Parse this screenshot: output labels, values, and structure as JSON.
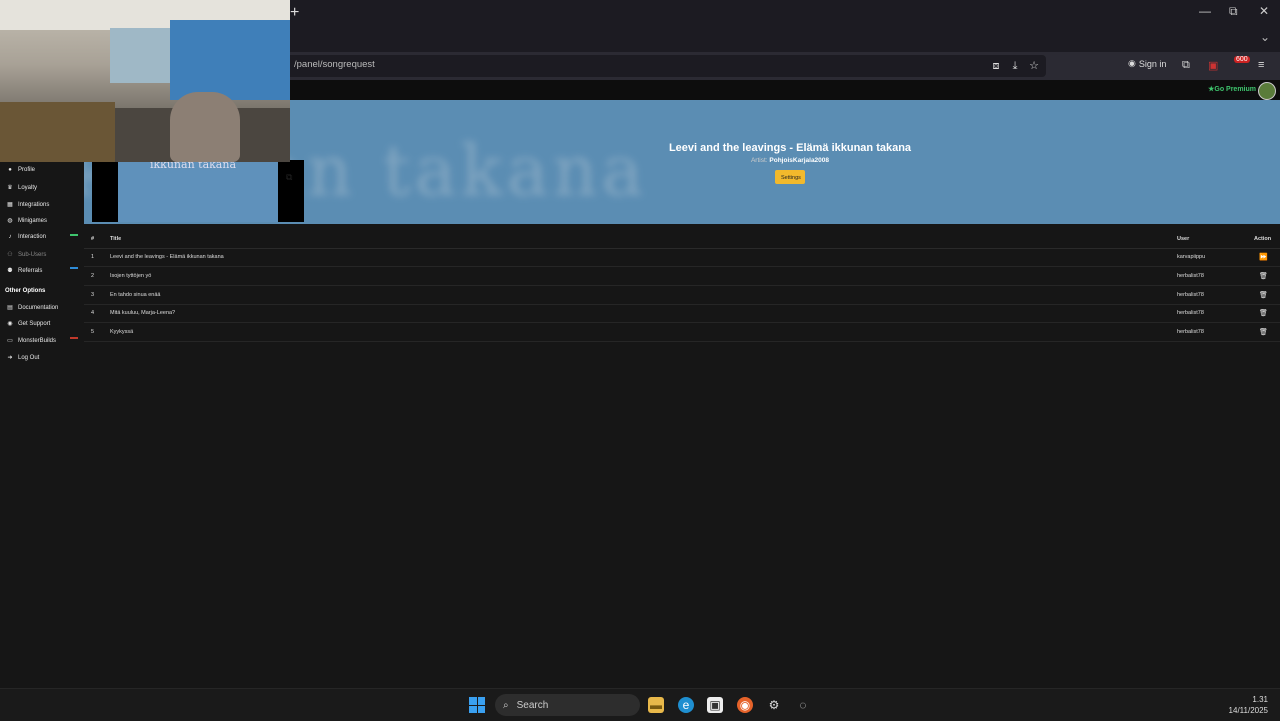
{
  "browser": {
    "new_tab": "+",
    "url": "/panel/songrequest",
    "sign_in": "Sign in",
    "extension_badge": "600",
    "window_controls": {
      "minimize": "—",
      "restore": "⧉",
      "close": "✕"
    }
  },
  "site_topbar": {
    "premium": "Go Premium"
  },
  "hero": {
    "background_text": "ikkunan takana",
    "thumbnail_caption": "ikkunan takana",
    "song_title": "Leevi and the leavings - Elämä ikkunan takana",
    "artist_label": "Artist:",
    "artist_name": "PohjoisKarjala2008",
    "settings_label": "Settings"
  },
  "sidebar": {
    "items": [
      {
        "label": "Profile",
        "icon": "person-icon"
      },
      {
        "label": "Loyalty",
        "icon": "trophy-icon"
      },
      {
        "label": "Integrations",
        "icon": "grid-icon"
      },
      {
        "label": "Minigames",
        "icon": "gamepad-icon"
      },
      {
        "label": "Interaction",
        "icon": "music-icon"
      },
      {
        "label": "Sub-Users",
        "icon": "users-icon"
      },
      {
        "label": "Referrals",
        "icon": "referrals-icon"
      }
    ],
    "other_heading": "Other Options",
    "other_items": [
      {
        "label": "Documentation",
        "icon": "book-icon"
      },
      {
        "label": "Get Support",
        "icon": "support-icon"
      },
      {
        "label": "MonsterBuilds",
        "icon": "monitor-icon"
      },
      {
        "label": "Log Out",
        "icon": "logout-icon"
      }
    ],
    "colors": {
      "interaction_bar": "#3ec46d",
      "referrals_bar": "#2e8bd6",
      "monsterbuilds_bar": "#c0392b"
    }
  },
  "queue": {
    "headers": {
      "number": "#",
      "title": "Title",
      "user": "User",
      "action": "Action"
    },
    "rows": [
      {
        "n": "1",
        "title": "Leevi and the leavings - Elämä ikkunan takana",
        "user": "karvapiippu",
        "action": "⏩"
      },
      {
        "n": "2",
        "title": "Isojen tyttöjen yö",
        "user": "herbalist78",
        "action": "🗑"
      },
      {
        "n": "3",
        "title": "En tahdo sinua enää",
        "user": "herbalist78",
        "action": "🗑"
      },
      {
        "n": "4",
        "title": "Mitä kuuluu, Marja-Leena?",
        "user": "herbalist78",
        "action": "🗑"
      },
      {
        "n": "5",
        "title": "Kyykyssä",
        "user": "herbalist78",
        "action": "🗑"
      }
    ]
  },
  "taskbar": {
    "search_label": "Search",
    "time": "1.31",
    "date": "14/11/2025"
  }
}
